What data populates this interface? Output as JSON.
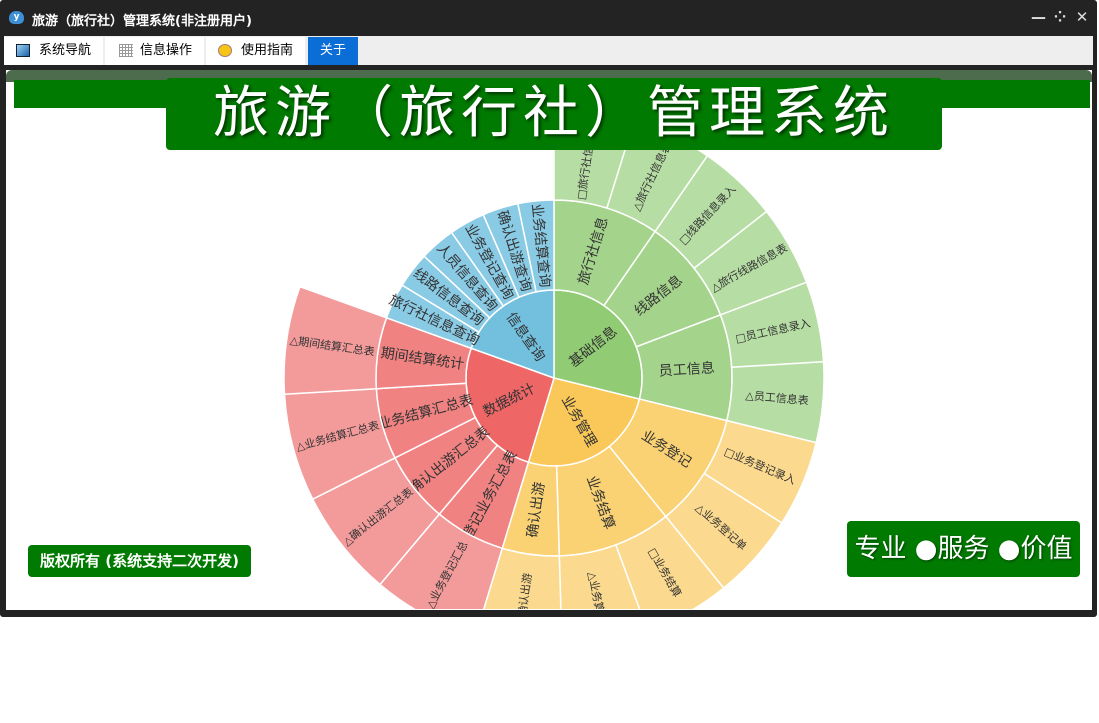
{
  "window": {
    "title": "旅游（旅行社）管理系统(非注册用户)",
    "app_icon_letter": "y",
    "controls": {
      "minimize": "—",
      "restore": "⁘",
      "close": "✕"
    }
  },
  "tabs": [
    {
      "label": "系统导航",
      "icon": "monitor-icon"
    },
    {
      "label": "信息操作",
      "icon": "grid-icon"
    },
    {
      "label": "使用指南",
      "icon": "help-icon"
    },
    {
      "label": "关于",
      "icon": "",
      "active": true
    }
  ],
  "banner": {
    "title": "旅游（旅行社）管理系统"
  },
  "footer": {
    "copyright": "版权所有 (系统支持二次开发)",
    "slogan": "专业 ●服务 ●价值"
  },
  "colors": {
    "green": [
      "#91cb74",
      "#a4d48c",
      "#b6dda3"
    ],
    "yellow": [
      "#fac858",
      "#fad274",
      "#fbd98e"
    ],
    "red": [
      "#ee6666",
      "#f08282",
      "#f39b9b"
    ],
    "blue": [
      "#73c0de",
      "#89cae4",
      "#89cae4"
    ],
    "brand_green": "#007a00",
    "active_tab": "#0a6ed6"
  },
  "chart_data": {
    "type": "sunburst",
    "start_angle_deg": 0,
    "children": [
      {
        "name": "基础信息",
        "color": "green",
        "children": [
          {
            "name": "旅行社信息",
            "children": [
              {
                "name": "□旅行社信息录入",
                "value": 17.3
              },
              {
                "name": "△旅行社信息表",
                "value": 17.3
              }
            ]
          },
          {
            "name": "线路信息",
            "children": [
              {
                "name": "□线路信息录入",
                "value": 17.3
              },
              {
                "name": "△旅行线路信息表",
                "value": 17.3
              }
            ]
          },
          {
            "name": "员工信息",
            "children": [
              {
                "name": "□员工信息录入",
                "value": 17.3
              },
              {
                "name": "△员工信息表",
                "value": 17.3
              }
            ]
          }
        ]
      },
      {
        "name": "业务管理",
        "color": "yellow",
        "children": [
          {
            "name": "业务登记",
            "children": [
              {
                "name": "□业务登记录入",
                "value": 18.6
              },
              {
                "name": "△业务登记单",
                "value": 18.6
              }
            ]
          },
          {
            "name": "业务结算",
            "children": [
              {
                "name": "□业务结算",
                "value": 18.6
              },
              {
                "name": "△业务算单",
                "value": 18.6
              }
            ]
          },
          {
            "name": "确认出游",
            "children": [
              {
                "name": "□确认出游",
                "value": 18.6
              }
            ]
          }
        ]
      },
      {
        "name": "数据统计",
        "color": "red",
        "children": [
          {
            "name": "登记业务汇总表",
            "children": [
              {
                "name": "△业务登记汇总",
                "value": 23.2
              }
            ]
          },
          {
            "name": "确认出游汇总表",
            "children": [
              {
                "name": "△确认出游汇总表",
                "value": 23.2
              }
            ]
          },
          {
            "name": "业务结算汇总表",
            "children": [
              {
                "name": "△业务结算汇总表",
                "value": 23.2
              }
            ]
          },
          {
            "name": "期间结算统计",
            "children": [
              {
                "name": "△期间结算汇总表",
                "value": 23.2
              }
            ]
          }
        ]
      },
      {
        "name": "信息查询",
        "color": "blue",
        "children": [
          {
            "name": "旅行社信息查询",
            "value": 11.7
          },
          {
            "name": "线路信息查询",
            "value": 11.7
          },
          {
            "name": "人员信息查询",
            "value": 11.7
          },
          {
            "name": "业务登记查询",
            "value": 11.7
          },
          {
            "name": "确认出游查询",
            "value": 11.7
          },
          {
            "name": "业务结算查询",
            "value": 11.7
          }
        ]
      }
    ]
  }
}
